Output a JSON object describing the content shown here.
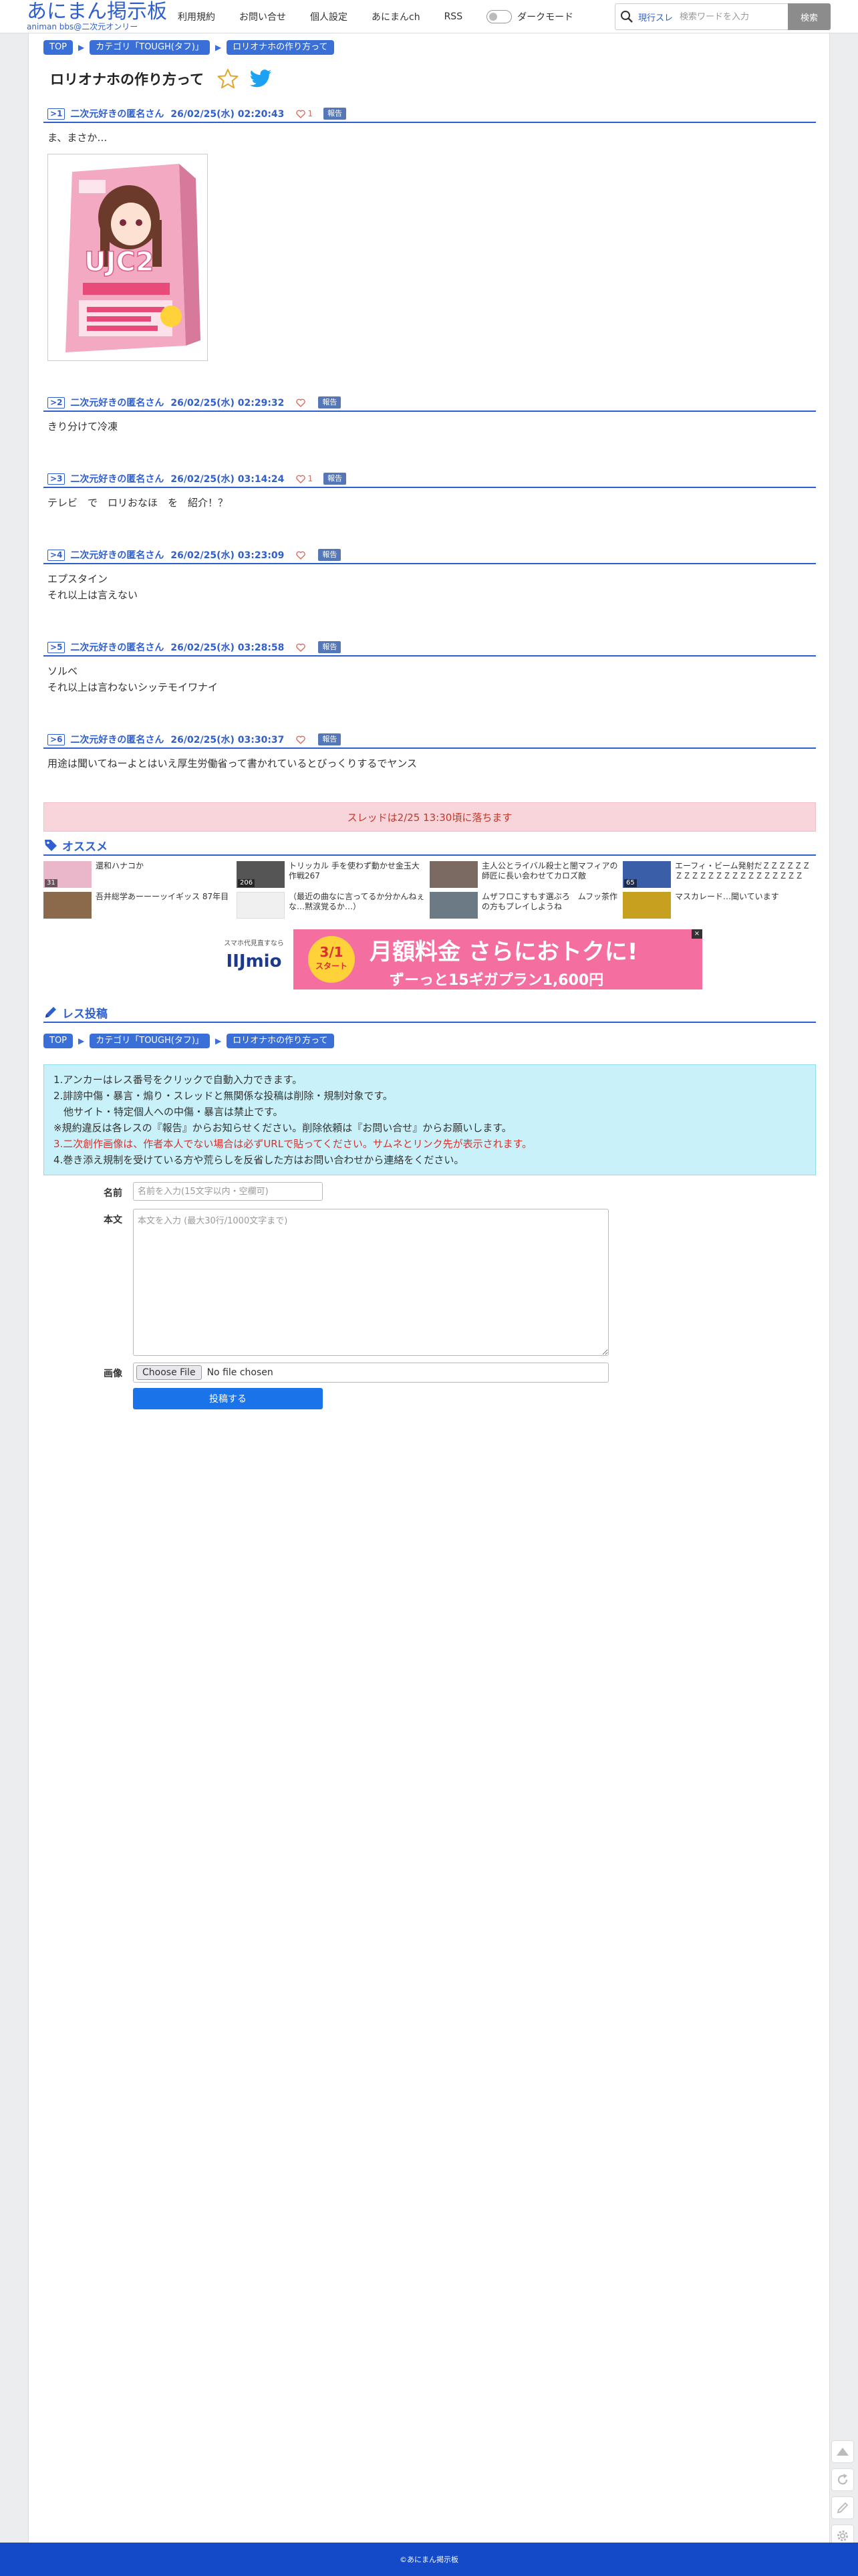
{
  "header": {
    "logo_title": "あにまん掲示板",
    "logo_sub": "animan bbs@二次元オンリー",
    "nav": [
      "利用規約",
      "お問い合せ",
      "個人設定",
      "あにまんch",
      "RSS"
    ],
    "dark_mode_label": "ダークモード",
    "search_mode": "現行スレ",
    "search_placeholder": "検索ワードを入力",
    "search_button": "検索"
  },
  "breadcrumb": [
    "TOP",
    "カテゴリ「TOUGH(タフ)」",
    "ロリオナホの作り方って"
  ],
  "thread": {
    "title": "ロリオナホの作り方って",
    "posts": [
      {
        "num": "1",
        "name": "二次元好きの匿名さん",
        "date": "26/02/25(水) 02:20:43",
        "likes": "1",
        "report": "報告",
        "lines": [
          "ま、まさか…"
        ],
        "image_alt": "ロリオナホ パッケージ画像"
      },
      {
        "num": "2",
        "name": "二次元好きの匿名さん",
        "date": "26/02/25(水) 02:29:32",
        "likes": "",
        "report": "報告",
        "lines": [
          "きり分けて冷凍"
        ]
      },
      {
        "num": "3",
        "name": "二次元好きの匿名さん",
        "date": "26/02/25(水) 03:14:24",
        "likes": "1",
        "report": "報告",
        "lines": [
          "テレビ　で　ロリおなほ　を　紹介！？"
        ]
      },
      {
        "num": "4",
        "name": "二次元好きの匿名さん",
        "date": "26/02/25(水) 03:23:09",
        "likes": "",
        "report": "報告",
        "lines": [
          "エプスタイン",
          "それ以上は言えない"
        ]
      },
      {
        "num": "5",
        "name": "二次元好きの匿名さん",
        "date": "26/02/25(水) 03:28:58",
        "likes": "",
        "report": "報告",
        "lines": [
          "ソルベ",
          "それ以上は言わないシッテモイワナイ"
        ]
      },
      {
        "num": "6",
        "name": "二次元好きの匿名さん",
        "date": "26/02/25(水) 03:30:37",
        "likes": "",
        "report": "報告",
        "lines": [
          "用途は聞いてねーよとはいえ厚生労働省って書かれているとびっくりするでヤンス"
        ]
      }
    ],
    "end_notice": "スレッドは2/25 13:30頃に落ちます"
  },
  "recommend": {
    "title": "オススメ",
    "items": [
      {
        "title": "還和ハナコか",
        "count": "31",
        "color": "#e9b7c9"
      },
      {
        "title": "トリッカル 手を使わず動かせ金玉大作戦267",
        "count": "206",
        "color": "#555555"
      },
      {
        "title": "主人公とライバル殺士と闇マフィアの師匠に長い会わせてカロズ敵",
        "count": "",
        "color": "#7a6a62"
      },
      {
        "title": "エーフィ・ビーム発射だＺＺＺＺＺＺＺＺＺＺＺＺＺＺＺＺＺＺＺＺＺＺ",
        "count": "65",
        "color": "#3a5ea8"
      },
      {
        "title": "吾井総学あーーーッイギッス 87年目",
        "count": "",
        "color": "#8a6a4a"
      },
      {
        "title": "（最近の曲なに言ってるか分かんねぇな…黙涙覚るか…）",
        "count": "",
        "color": "#f0f0f0"
      },
      {
        "title": "ムザフロこすもす選ぶろ　ムフッ茶作の方もプレイしようね",
        "count": "",
        "color": "#6b7a84"
      },
      {
        "title": "マスカレード…聞いています",
        "count": "",
        "color": "#c8a020"
      }
    ]
  },
  "banner": {
    "brand": "IIJmio",
    "brand_sub": "スマホ代見直すなら",
    "badge_top": "3/1",
    "badge_bottom": "スタート",
    "headline": "月額料金 さらにおトクに!",
    "sub": "ずーっと15ギガプラン1,600円",
    "close": "×"
  },
  "form": {
    "title": "レス投稿",
    "notes": [
      {
        "text": "1.アンカーはレス番号をクリックで自動入力できます。",
        "style": ""
      },
      {
        "text": "2.誹謗中傷・暴言・煽り・スレッドと無関係な投稿は削除・規制対象です。",
        "style": ""
      },
      {
        "text": "　他サイト・特定個人への中傷・暴言は禁止です。",
        "style": ""
      },
      {
        "text": "※規約違反は各レスの『報告』からお知らせください。削除依頼は『お問い合せ』からお願いします。",
        "style": ""
      },
      {
        "text": "3.二次創作画像は、作者本人でない場合は必ずURLで貼ってください。サムネとリンク先が表示されます。",
        "style": "red"
      },
      {
        "text": "4.巻き添え規制を受けている方や荒らしを反省した方はお問い合わせから連絡をください。",
        "style": ""
      }
    ],
    "name_label": "名前",
    "name_placeholder": "名前を入力(15文字以内・空欄可)",
    "body_label": "本文",
    "body_placeholder": "本文を入力 (最大30行/1000文字まで)",
    "image_label": "画像",
    "file_button": "Choose File",
    "file_status": "No file chosen",
    "submit": "投稿する"
  },
  "footer": {
    "copyright": "©あにまん掲示板"
  },
  "colors": {
    "accent": "#2f5fcf",
    "crumb": "#3a6fd8",
    "end_bg": "#f7d5da",
    "note_bg": "#c9f1f9",
    "footer": "#1449c8",
    "submit": "#1a73e8"
  }
}
